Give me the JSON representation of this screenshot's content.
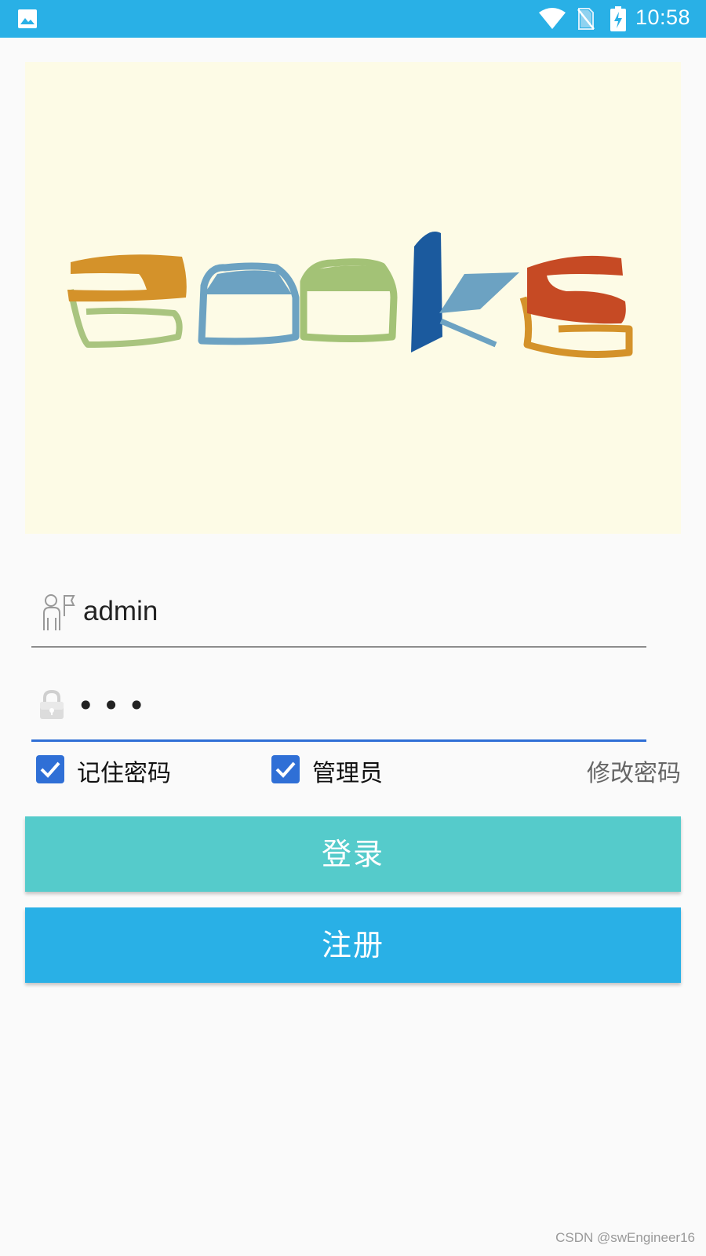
{
  "status_bar": {
    "time": "10:58",
    "background": "#29b0e6",
    "icons": [
      "gallery-icon",
      "wifi-icon",
      "no-sim-icon",
      "battery-charging-icon"
    ]
  },
  "banner": {
    "logo_text": "Books",
    "background": "#fdfbe6"
  },
  "login_form": {
    "username": {
      "value": "admin",
      "icon": "user-icon"
    },
    "password": {
      "masked_value": "•••",
      "icon": "lock-icon"
    },
    "remember_password": {
      "label": "记住密码",
      "checked": true
    },
    "admin": {
      "label": "管理员",
      "checked": true
    },
    "change_password_label": "修改密码",
    "login_button": "登录",
    "register_button": "注册"
  },
  "colors": {
    "accent": "#2f6fd6",
    "login_button": "#55cbcb",
    "register_button": "#29b0e6"
  },
  "watermark": "CSDN @swEngineer16"
}
